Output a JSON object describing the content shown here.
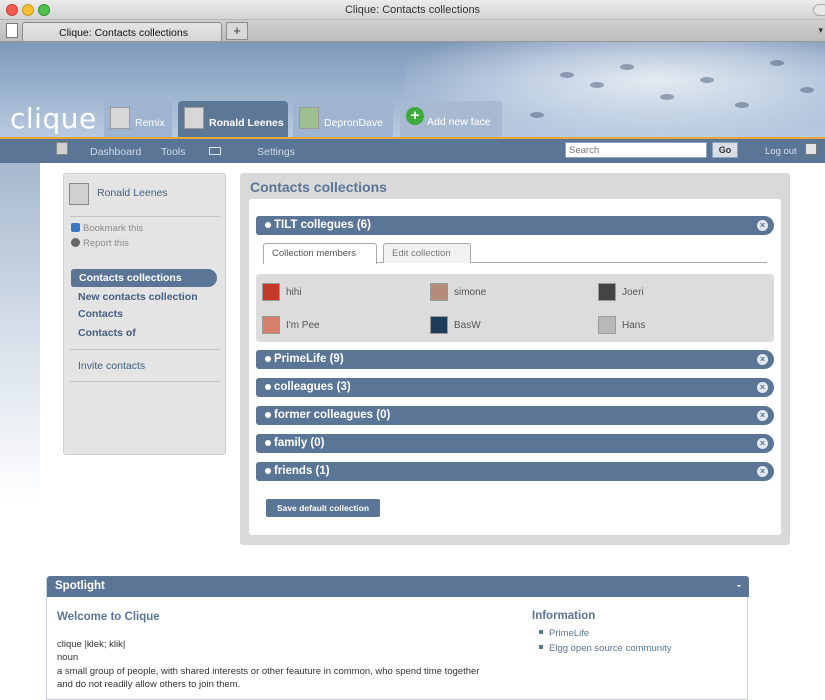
{
  "window": {
    "title": "Clique: Contacts collections"
  },
  "browser_tab": {
    "label": "Clique: Contacts collections",
    "new_tab": "+"
  },
  "header": {
    "logo": "clique",
    "faces": [
      {
        "label": "Remix"
      },
      {
        "label": "Ronald Leenes"
      },
      {
        "label": "DepronDave"
      },
      {
        "label": "Add new face"
      }
    ]
  },
  "nav": {
    "dashboard": "Dashboard",
    "tools": "Tools",
    "settings": "Settings",
    "search_placeholder": "Search",
    "go": "Go",
    "logout": "Log out"
  },
  "sidebar": {
    "user": "Ronald Leenes",
    "bookmark": "Bookmark this",
    "report": "Report this",
    "active": "Contacts collections",
    "links": [
      "New contacts collection",
      "Contacts",
      "Contacts of"
    ],
    "invite": "Invite contacts"
  },
  "main": {
    "title": "Contacts collections",
    "expanded": {
      "name": "TILT collegues (6)",
      "tabs": [
        "Collection members",
        "Edit collection"
      ],
      "members": [
        "hihi",
        "simone",
        "Joeri",
        "I'm Pee",
        "BasW",
        "Hans"
      ]
    },
    "collections": [
      "PrimeLife (9)",
      "colleagues (3)",
      "former colleagues (0)",
      "family (0)",
      "friends (1)"
    ],
    "close_glyph": "×",
    "save_button": "Save default collection"
  },
  "spotlight": {
    "title": "Spotlight",
    "toggle": "-",
    "welcome": "Welcome to Clique",
    "word": "clique |klek; klik|",
    "pos": "noun",
    "definition": "a small group of people, with shared interests or other feauture in common, who spend time together and do not readily allow others to join them.",
    "info_title": "Information",
    "info_links": [
      "PrimeLife",
      "Elgg open source community"
    ]
  },
  "colors": {
    "accent": "#5a7596",
    "nav_border": "#e6a63a",
    "add_face": "#3cab3c"
  }
}
